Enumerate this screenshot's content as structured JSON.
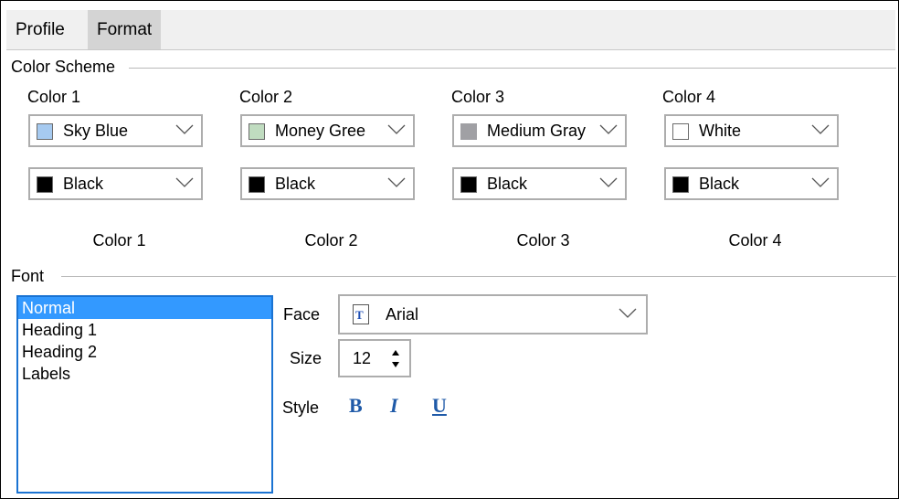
{
  "tabs": [
    {
      "label": "Profile"
    },
    {
      "label": "Format"
    }
  ],
  "color_scheme": {
    "group_label": "Color Scheme",
    "columns": [
      {
        "header": "Color 1",
        "fg": {
          "name": "Sky Blue",
          "color": "#a6caf0"
        },
        "bg": {
          "name": "Black",
          "color": "#000000"
        },
        "footer": "Color 1"
      },
      {
        "header": "Color 2",
        "fg": {
          "name": "Money Gree",
          "color": "#c0dcc0"
        },
        "bg": {
          "name": "Black",
          "color": "#000000"
        },
        "footer": "Color 2"
      },
      {
        "header": "Color 3",
        "fg": {
          "name": "Medium Gray",
          "color": "#a0a0a4"
        },
        "bg": {
          "name": "Black",
          "color": "#000000"
        },
        "footer": "Color 3"
      },
      {
        "header": "Color 4",
        "fg": {
          "name": "White",
          "color": "#ffffff"
        },
        "bg": {
          "name": "Black",
          "color": "#000000"
        },
        "footer": "Color 4"
      }
    ]
  },
  "font": {
    "group_label": "Font",
    "items": [
      "Normal",
      "Heading 1",
      "Heading 2",
      "Labels"
    ],
    "selected_index": 0,
    "face_label": "Face",
    "face_value": "Arial",
    "size_label": "Size",
    "size_value": "12",
    "style_label": "Style",
    "style_buttons": [
      "B",
      "I",
      "U"
    ]
  },
  "colors": {
    "list_selection": "#3399ff",
    "list_border": "#1a73d2",
    "style_button": "#1f5aa8"
  }
}
